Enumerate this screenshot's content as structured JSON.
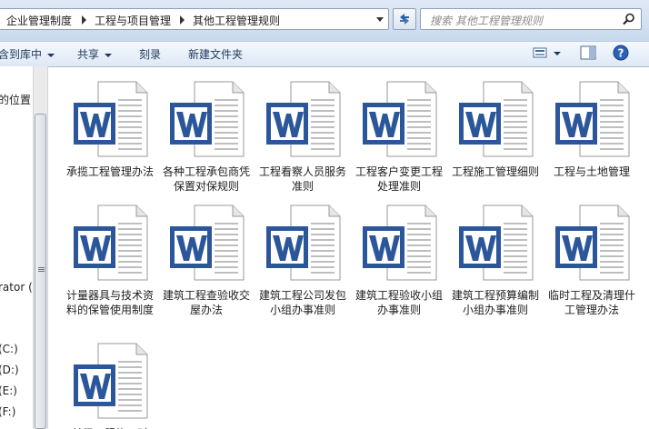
{
  "breadcrumb": [
    "企业管理制度",
    "工程与项目管理",
    "其他工程管理规则"
  ],
  "search": {
    "placeholder": "搜索 其他工程管理规则"
  },
  "toolbar": {
    "include_in_library": "含到库中",
    "share": "共享",
    "burn": "刻录",
    "new_folder": "新建文件夹"
  },
  "nav": {
    "items": [
      "的位置",
      "rator (l",
      "(C:)",
      "(D:)",
      "(E:)",
      "(F:)"
    ]
  },
  "files": [
    "承揽工程管理办法",
    "各种工程承包商凭保置对保规则",
    "工程看察人员服务准则",
    "工程客户变更工程处理准则",
    "工程施工管理细则",
    "工程与土地管理",
    "计量器具与技术资料的保管使用制度",
    "建筑工程查验收交屋办法",
    "建筑工程公司发包小组办事准则",
    "建筑工程验收小组办事准则",
    "建筑工程预算编制小组办事准则",
    "临时工程及清理什工管理办法",
    "关于工程施工时"
  ],
  "colors": {
    "word_blue": "#2b579a",
    "toolbar_text": "#1e395b"
  }
}
